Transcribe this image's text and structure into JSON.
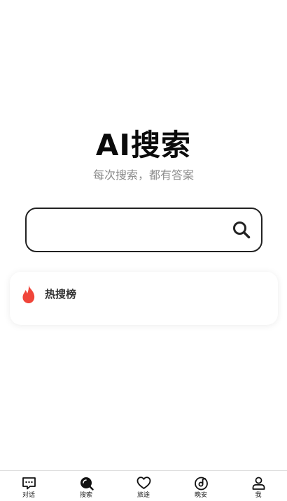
{
  "hero": {
    "title": "AI搜索",
    "subtitle": "每次搜索，都有答案"
  },
  "search": {
    "value": "",
    "placeholder": ""
  },
  "hot": {
    "title": "热搜榜"
  },
  "tabbar": {
    "tabs": [
      {
        "label": "对话",
        "icon": "chat-icon"
      },
      {
        "label": "搜索",
        "icon": "search-icon",
        "active": true
      },
      {
        "label": "旅途",
        "icon": "heart-icon"
      },
      {
        "label": "晚安",
        "icon": "music-disc-icon"
      },
      {
        "label": "我",
        "icon": "person-icon"
      }
    ]
  },
  "colors": {
    "accent_flame": "#f0453a",
    "subtitle": "#8a8a8a",
    "border": "#222222"
  }
}
